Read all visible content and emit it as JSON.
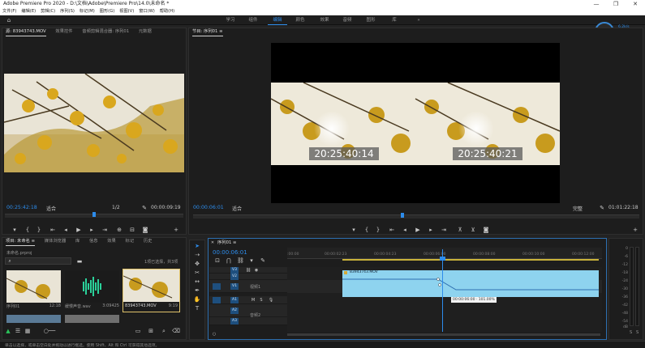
{
  "app": {
    "title": "Adobe Premiere Pro 2020 - D:\\文档\\Adobe\\Premiere Pro\\14.0\\未命名 *",
    "window_controls": [
      "—",
      "❐",
      "✕"
    ]
  },
  "menu": [
    "文件(F)",
    "编辑(E)",
    "剪辑(C)",
    "序列(S)",
    "标记(M)",
    "图形(G)",
    "视图(V)",
    "窗口(W)",
    "帮助(H)"
  ],
  "workspaces": {
    "items": [
      "学习",
      "组件",
      "编辑",
      "颜色",
      "效果",
      "音频",
      "图形",
      "库"
    ],
    "active": "编辑",
    "more": "»"
  },
  "perf_badge": {
    "percent": "36",
    "suffix": "%",
    "line1": "6.2k/s",
    "line2": "0.4k/s"
  },
  "source_panel": {
    "tabs": [
      "源: 83943743.MOV",
      "效果控件",
      "音频剪辑混合器: 序列01",
      "元数据"
    ],
    "timecode": "00:25:42:18",
    "fit": "适合",
    "ratio": "1/2",
    "duration": "00:00:09:19"
  },
  "program_panel": {
    "tab": "节目: 序列01 ≡",
    "timecode": "00:00:06:01",
    "fit": "适合",
    "quality": "完整",
    "duration": "01:01:22:18",
    "overlay_left": "20:25:40:14",
    "overlay_right": "20:25:40:21"
  },
  "project_panel": {
    "tabs": [
      "项目: 未命名 ≡",
      "媒体浏览器",
      "库",
      "信息",
      "效果",
      "标记",
      "历史"
    ],
    "file": "未命名.prproj",
    "selection": "1项已选择，共3项",
    "items": [
      {
        "name": "序列01",
        "duration": "12:18"
      },
      {
        "name": "缓慢声音.wav",
        "duration": "3:09425"
      },
      {
        "name": "83943743.MOV",
        "duration": "9:19"
      }
    ]
  },
  "timeline": {
    "tab": "序列01 ≡",
    "timecode": "00:00:06:01",
    "ruler": [
      ":00:00",
      "00:00:02:23",
      "00:00:04:23",
      "00:00:06:00",
      "00:00:08:00",
      "00:00:10:00",
      "00:00:12:00"
    ],
    "tracks": [
      "V3",
      "V2",
      "V1",
      "A1",
      "A2",
      "A3"
    ],
    "track_names": {
      "v1": "视频1",
      "a2": "音频2"
    },
    "clip_label": "83943743.MOV",
    "tooltip": "00:00:06:00 · 101.00%"
  },
  "audio_meter": {
    "scale": [
      "0",
      "-6",
      "-12",
      "-18",
      "-24",
      "-30",
      "-36",
      "-42",
      "-48",
      "-54",
      "dB"
    ],
    "channels": [
      "S",
      "S"
    ]
  },
  "status_bar": "单击以选择，或单击空白处并拖动以进行框选。使用 Shift、Alt 和 Ctrl 可获得其他选项。",
  "colors": {
    "accent": "#2d8ceb",
    "clip": "#8ed3ef",
    "panel": "#1d1d1d"
  }
}
